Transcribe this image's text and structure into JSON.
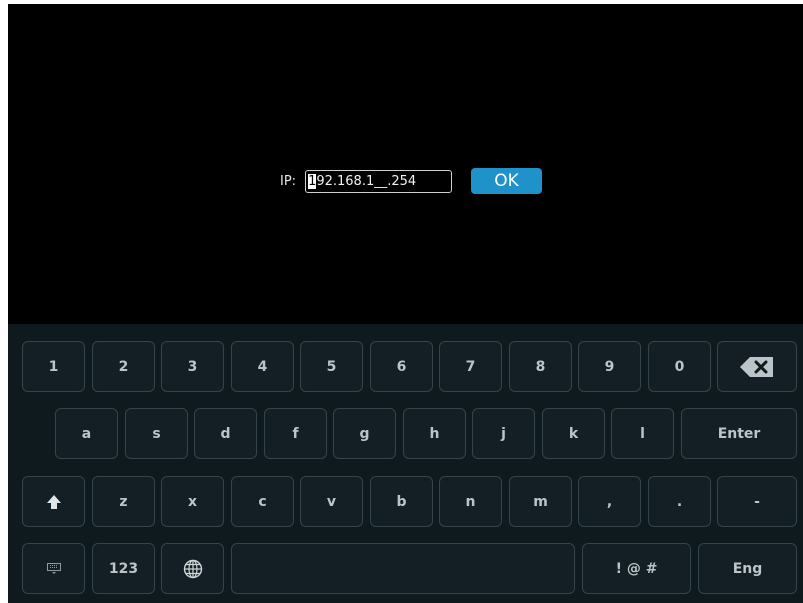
{
  "ip_entry": {
    "label": "IP:",
    "value_cursor_char": "1",
    "value_rest": "92.168.1__.254",
    "ok_label": "OK"
  },
  "keyboard": {
    "row1": [
      "1",
      "2",
      "3",
      "4",
      "5",
      "6",
      "7",
      "8",
      "9",
      "0"
    ],
    "row2": [
      "a",
      "s",
      "d",
      "f",
      "g",
      "h",
      "j",
      "k",
      "l"
    ],
    "enter_label": "Enter",
    "row3": [
      "z",
      "x",
      "c",
      "v",
      "b",
      "n",
      "m",
      ",",
      ".",
      "-"
    ],
    "numbers_label": "123",
    "symbols_label": "! @ #",
    "language_label": "Eng",
    "icons": {
      "backspace": "backspace-icon",
      "shift": "shift-arrow-icon",
      "keyboard": "keyboard-icon",
      "globe": "globe-icon"
    }
  },
  "colors": {
    "background": "#000000",
    "keyboard_bg": "#0f1a1f",
    "key_border": "#34444b",
    "ok_button": "#1f93c9"
  }
}
